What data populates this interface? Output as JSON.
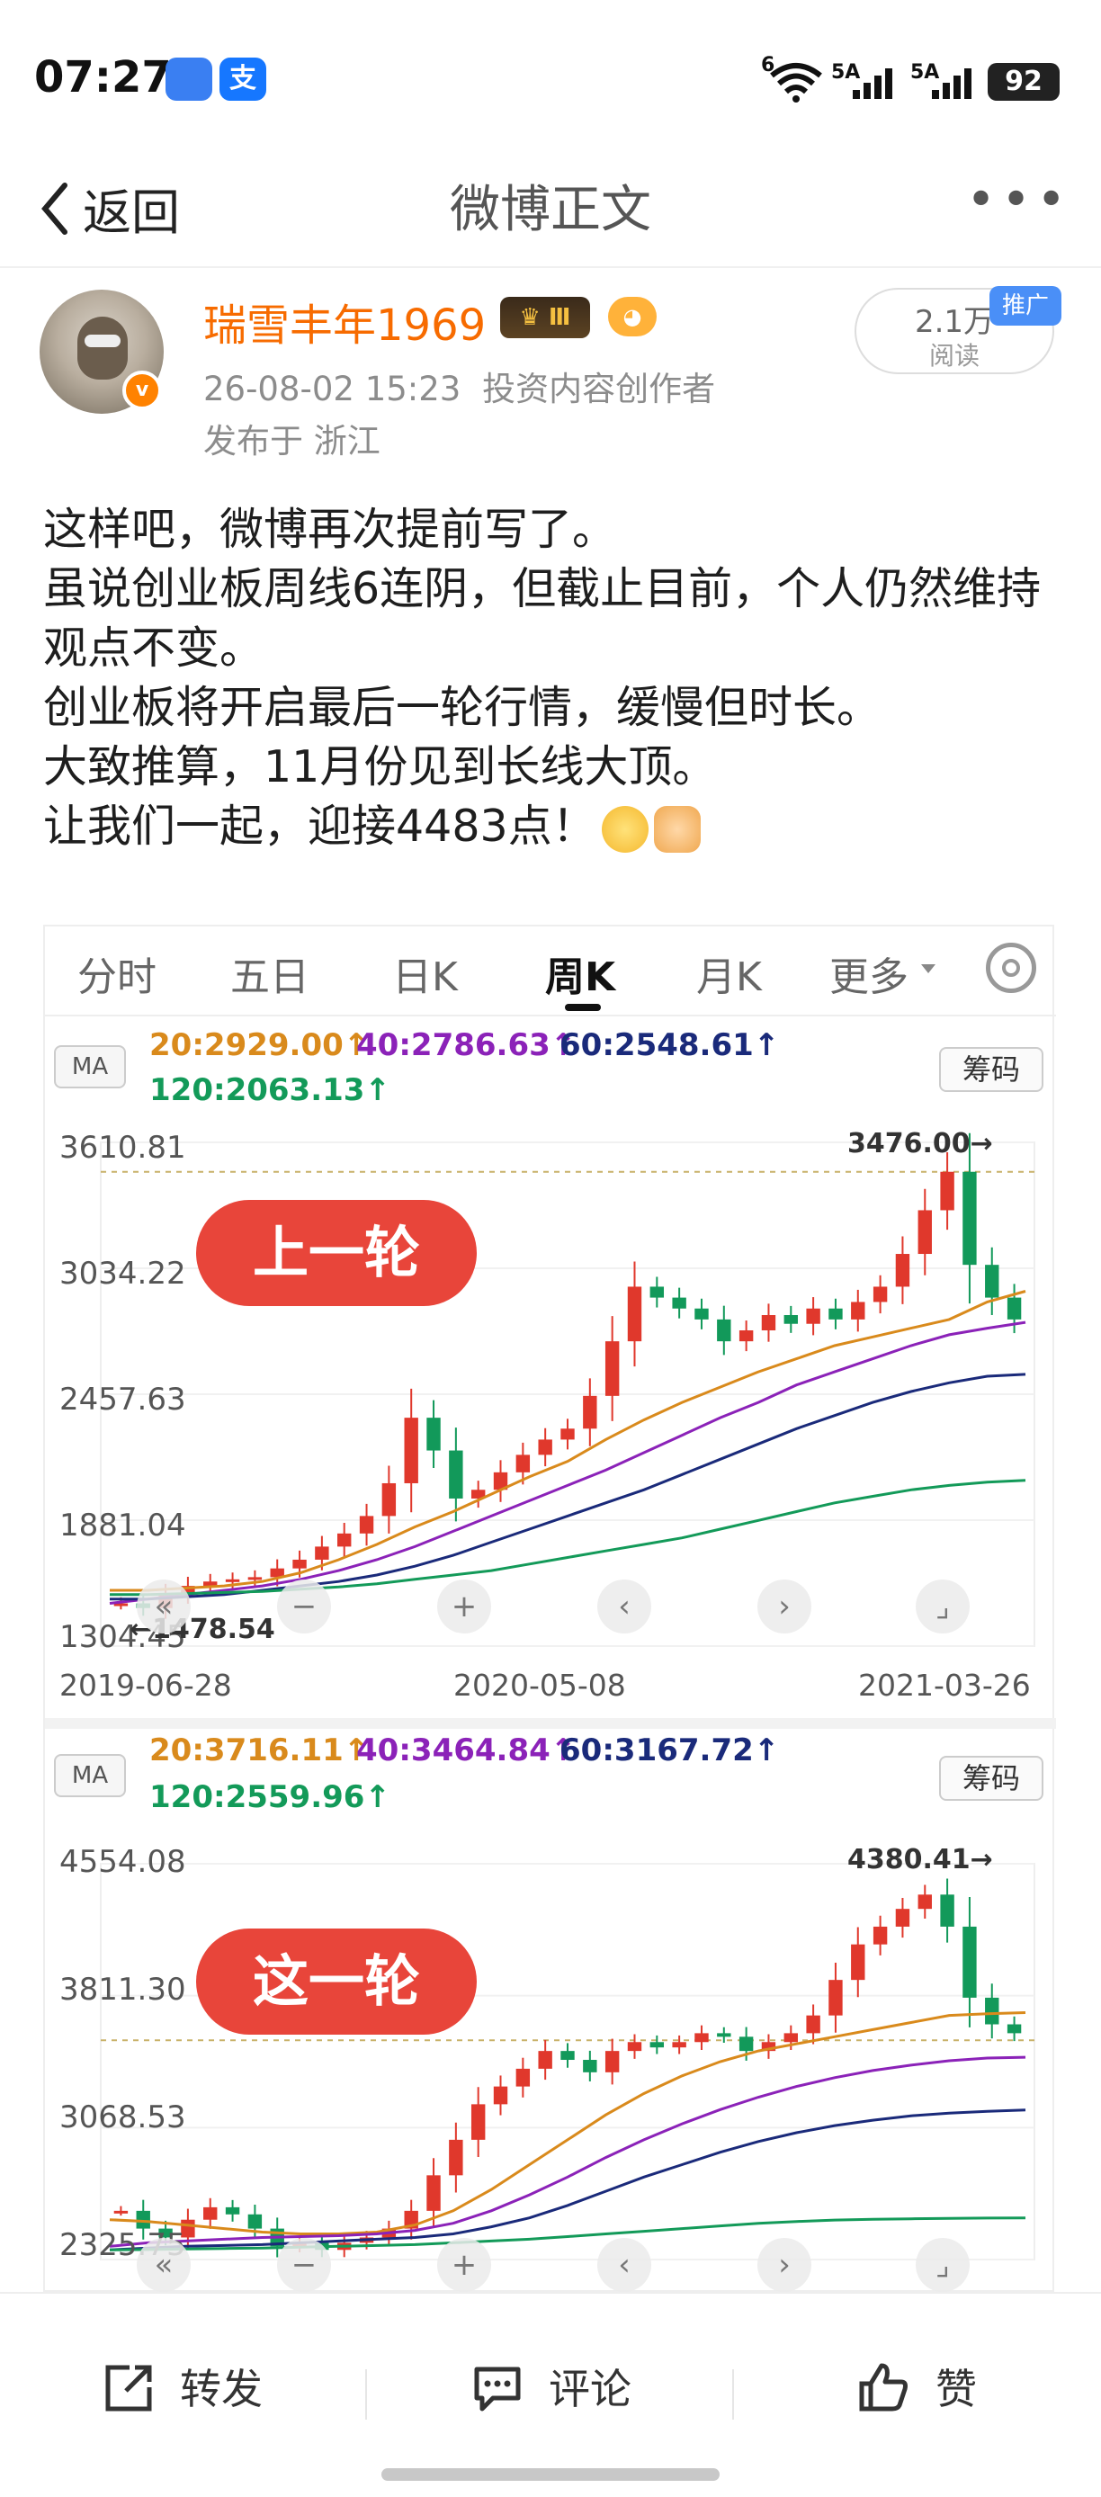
{
  "status_bar": {
    "time": "07:27",
    "app_badge_1": "",
    "app_badge_2": "支",
    "signal_1": "5A",
    "signal_2": "5A",
    "wifi": "6",
    "battery": "92"
  },
  "nav": {
    "back_label": "返回",
    "title": "微博正文",
    "more": "•••"
  },
  "post_header": {
    "username": "瑞雪丰年1969",
    "level_badge": "Ⅲ",
    "timestamp": "26-08-02 15:23",
    "role": "投资内容创作者",
    "location": "发布于 浙江",
    "reads_count": "2.1万",
    "reads_label": "阅读",
    "promo_label": "推广"
  },
  "post_text": [
    "这样吧，微博再次提前写了。",
    "虽说创业板周线6连阴，但截止目前，个人仍然维持观点不变。",
    "创业板将开启最后一轮行情，缓慢但时长。",
    "大致推算，11月份见到长线大顶。",
    "让我们一起，迎接4483点！"
  ],
  "chart_tabs": [
    "分时",
    "五日",
    "日K",
    "周K",
    "月K",
    "更多"
  ],
  "chart_tabs_active": "周K",
  "colors": {
    "ma20": "#d98a1c",
    "ma40": "#8b22b8",
    "ma60": "#1a2a7a",
    "ma120": "#139a59",
    "up_candle": "#e0382c",
    "down_candle": "#12995a",
    "label_pill": "#e8453a",
    "username": "#f76b00"
  },
  "icons": [
    "wifi-icon",
    "signal-icon",
    "battery-icon",
    "back-chevron-icon",
    "more-dots-icon",
    "verified-badge-icon",
    "crown-badge-icon",
    "fish-badge-icon",
    "settings-gear-icon",
    "share-icon",
    "comment-icon",
    "like-icon"
  ],
  "chart_data": [
    {
      "type": "candlestick",
      "label": "上一轮",
      "ma_button": "MA",
      "chip_button": "筹码",
      "ma_legend": {
        "ma20": "20:2929.00↑",
        "ma40": "40:2786.63↑",
        "ma60": "60:2548.61↑",
        "ma120": "120:2063.13↑"
      },
      "ylim": [
        1304.45,
        3610.81
      ],
      "y_ticks": [
        "3610.81",
        "3034.22",
        "2457.63",
        "1881.04",
        "1304.45"
      ],
      "x_ticks": [
        "2019-06-28",
        "2020-05-08",
        "2021-03-26"
      ],
      "peak_label": "3476.00→",
      "trough_label": "←1478.54",
      "peak": 3476.0,
      "trough": 1478.54,
      "reference_line": 3476.0,
      "series": [
        {
          "name": "K",
          "values": [
            1500,
            1478.54,
            1540,
            1580,
            1600,
            1610,
            1620,
            1660,
            1700,
            1760,
            1820,
            1900,
            2050,
            2350,
            2200,
            1980,
            2020,
            2100,
            2180,
            2250,
            2300,
            2450,
            2700,
            2950,
            2900,
            2850,
            2800,
            2700,
            2750,
            2820,
            2780,
            2850,
            2800,
            2880,
            2950,
            3100,
            3300,
            3476.0,
            3050,
            2900,
            2800
          ]
        },
        {
          "name": "MA20",
          "values": [
            1560,
            1560,
            1570,
            1580,
            1600,
            1640,
            1700,
            1770,
            1850,
            1920,
            2000,
            2080,
            2150,
            2250,
            2340,
            2420,
            2490,
            2560,
            2620,
            2680,
            2720,
            2760,
            2800,
            2880,
            2929
          ]
        },
        {
          "name": "MA40",
          "values": [
            1500,
            1520,
            1540,
            1560,
            1580,
            1610,
            1650,
            1700,
            1760,
            1830,
            1900,
            1970,
            2040,
            2110,
            2190,
            2270,
            2350,
            2420,
            2500,
            2560,
            2620,
            2680,
            2730,
            2760,
            2786.63
          ]
        },
        {
          "name": "MA60",
          "values": [
            1520,
            1520,
            1530,
            1540,
            1560,
            1580,
            1600,
            1630,
            1670,
            1720,
            1780,
            1840,
            1900,
            1960,
            2020,
            2090,
            2160,
            2230,
            2300,
            2360,
            2420,
            2470,
            2510,
            2540,
            2548.61
          ]
        },
        {
          "name": "MA120",
          "values": [
            1540,
            1540,
            1545,
            1550,
            1555,
            1565,
            1575,
            1590,
            1610,
            1630,
            1650,
            1680,
            1710,
            1740,
            1770,
            1800,
            1840,
            1880,
            1920,
            1960,
            1990,
            2020,
            2040,
            2055,
            2063.13
          ]
        }
      ]
    },
    {
      "type": "candlestick",
      "label": "这一轮",
      "ma_button": "MA",
      "chip_button": "筹码",
      "ma_legend": {
        "ma20": "20:3716.11↑",
        "ma40": "40:3464.84↑",
        "ma60": "60:3167.72↑",
        "ma120": "120:2559.96↑"
      },
      "ylim": [
        2325.75,
        4554.08
      ],
      "y_ticks": [
        "4554.08",
        "3811.30",
        "3068.53",
        "2325.75"
      ],
      "peak_label": "4380.41→",
      "peak": 4380.41,
      "reference_line": 3560,
      "series": [
        {
          "name": "K",
          "values": [
            2600,
            2500,
            2450,
            2550,
            2620,
            2580,
            2500,
            2400,
            2420,
            2380,
            2420,
            2450,
            2500,
            2600,
            2800,
            3000,
            3200,
            3300,
            3400,
            3500,
            3450,
            3380,
            3500,
            3550,
            3520,
            3550,
            3600,
            3580,
            3500,
            3550,
            3600,
            3700,
            3900,
            4100,
            4200,
            4300,
            4380.41,
            4200,
            3800,
            3650,
            3600
          ]
        },
        {
          "name": "MA20",
          "values": [
            2550,
            2540,
            2520,
            2500,
            2480,
            2470,
            2470,
            2480,
            2520,
            2600,
            2720,
            2860,
            3000,
            3140,
            3260,
            3360,
            3440,
            3500,
            3540,
            3580,
            3620,
            3660,
            3700,
            3710,
            3716.11
          ]
        },
        {
          "name": "MA40",
          "values": [
            2400,
            2420,
            2430,
            2440,
            2450,
            2455,
            2460,
            2470,
            2490,
            2530,
            2600,
            2690,
            2790,
            2900,
            3000,
            3090,
            3170,
            3240,
            3300,
            3350,
            3390,
            3420,
            3445,
            3460,
            3464.84
          ]
        },
        {
          "name": "MA60",
          "values": [
            2380,
            2390,
            2400,
            2405,
            2410,
            2420,
            2430,
            2440,
            2450,
            2470,
            2510,
            2560,
            2630,
            2710,
            2790,
            2860,
            2930,
            2990,
            3040,
            3080,
            3110,
            3135,
            3150,
            3160,
            3167.72
          ]
        },
        {
          "name": "MA120",
          "values": [
            2380,
            2382,
            2385,
            2388,
            2390,
            2395,
            2400,
            2405,
            2410,
            2420,
            2430,
            2440,
            2455,
            2470,
            2485,
            2500,
            2515,
            2530,
            2540,
            2548,
            2552,
            2555,
            2557,
            2559,
            2559.96
          ]
        }
      ]
    }
  ],
  "bottom_bar": {
    "repost_label": "转发",
    "comment_label": "评论",
    "like_label": "赞"
  }
}
